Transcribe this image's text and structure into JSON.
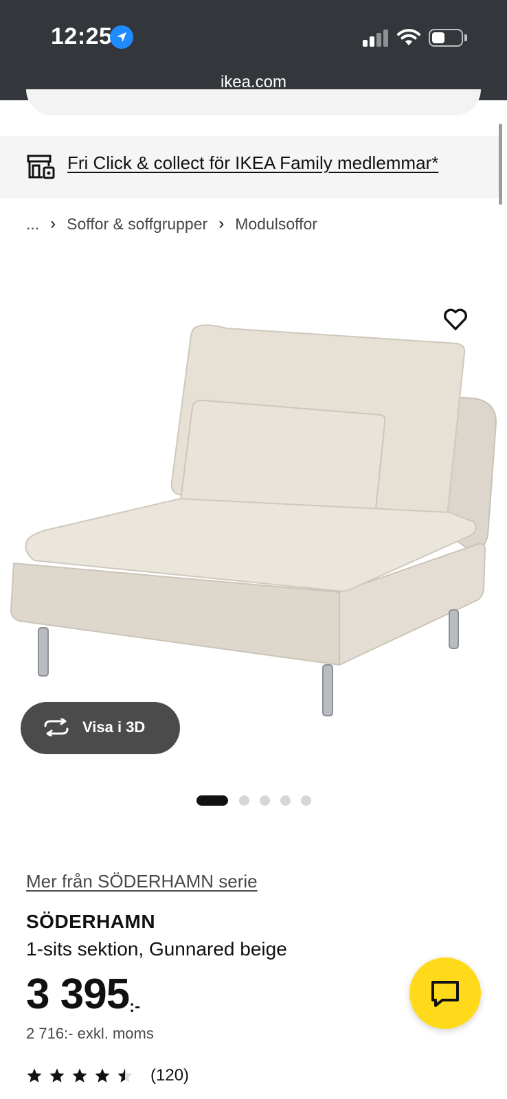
{
  "status_bar": {
    "time": "12:25",
    "url": "ikea.com",
    "icons": [
      "location-arrow-icon",
      "cellular-signal-icon",
      "wifi-icon",
      "battery-icon"
    ]
  },
  "promo": {
    "text": "Fri Click & collect för IKEA Family medlemmar*",
    "icon": "store-icon"
  },
  "breadcrumb": {
    "ellipsis": "...",
    "items": [
      "Soffor & soffgrupper",
      "Modulsoffor"
    ]
  },
  "gallery": {
    "view_3d_label": "Visa i 3D",
    "image_count": 5,
    "active_index": 0
  },
  "product": {
    "series_link": "Mer från SÖDERHAMN serie",
    "name": "SÖDERHAMN",
    "description": "1-sits sektion, Gunnared beige",
    "price": "3 395",
    "price_suffix": ":-",
    "price_excl_vat": "2 716:- exkl. moms",
    "rating": 4.5,
    "review_count": "(120)"
  },
  "colors": {
    "status_bar_bg": "#33363a",
    "promo_bg": "#f5f5f5",
    "button_dark": "#4b4b4b",
    "chat_yellow": "#ffda1a",
    "sofa_fabric": "#e6e0d6"
  }
}
